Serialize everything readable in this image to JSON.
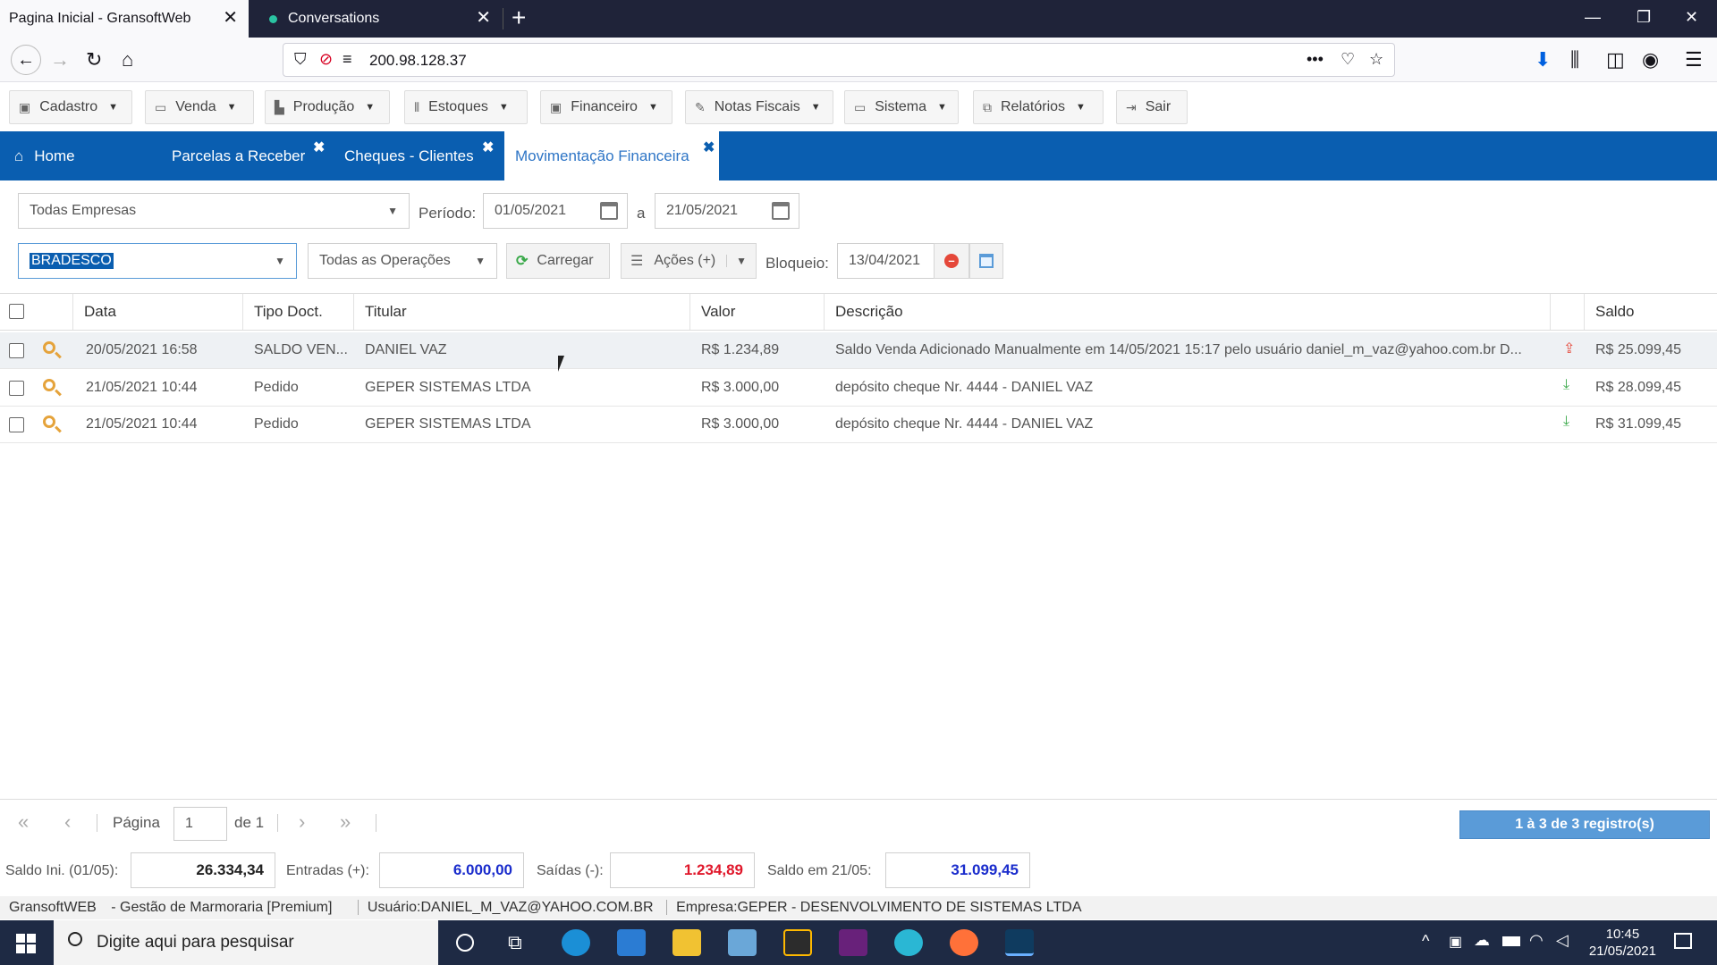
{
  "browser": {
    "tabs": [
      {
        "title": "Pagina Inicial - GransoftWeb",
        "active": true
      },
      {
        "title": "Conversations",
        "active": false
      }
    ],
    "url": "200.98.128.37"
  },
  "menu": [
    {
      "label": "Cadastro"
    },
    {
      "label": "Venda"
    },
    {
      "label": "Produção"
    },
    {
      "label": "Estoques"
    },
    {
      "label": "Financeiro"
    },
    {
      "label": "Notas Fiscais"
    },
    {
      "label": "Sistema"
    },
    {
      "label": "Relatórios"
    },
    {
      "label": "Sair"
    }
  ],
  "app_tabs": [
    {
      "label": "Home"
    },
    {
      "label": "Parcelas a Receber"
    },
    {
      "label": "Cheques - Clientes"
    },
    {
      "label": "Movimentação Financeira"
    }
  ],
  "filters": {
    "empresa": "Todas Empresas",
    "periodo_label": "Período:",
    "date_from": "01/05/2021",
    "a_label": "a",
    "date_to": "21/05/2021",
    "conta": "BRADESCO",
    "operacoes": "Todas as Operações",
    "carregar": "Carregar",
    "acoes": "Ações (+)",
    "bloqueio_label": "Bloqueio:",
    "bloqueio_date": "13/04/2021"
  },
  "grid": {
    "headers": {
      "data": "Data",
      "tipo": "Tipo Doct.",
      "titular": "Titular",
      "valor": "Valor",
      "descricao": "Descrição",
      "saldo": "Saldo"
    },
    "rows": [
      {
        "data": "20/05/2021 16:58",
        "tipo": "SALDO VEN...",
        "titular": "DANIEL VAZ",
        "valor": "R$ 1.234,89",
        "descricao": "Saldo Venda Adicionado Manualmente em 14/05/2021 15:17 pelo usuário daniel_m_vaz@yahoo.com.br D...",
        "saldo": "R$ 25.099,45",
        "direction": "out"
      },
      {
        "data": "21/05/2021 10:44",
        "tipo": "Pedido",
        "titular": "GEPER SISTEMAS LTDA",
        "valor": "R$ 3.000,00",
        "descricao": "depósito cheque Nr. 4444 - DANIEL VAZ",
        "saldo": "R$ 28.099,45",
        "direction": "in"
      },
      {
        "data": "21/05/2021 10:44",
        "tipo": "Pedido",
        "titular": "GEPER SISTEMAS LTDA",
        "valor": "R$ 3.000,00",
        "descricao": "depósito cheque Nr. 4444 - DANIEL VAZ",
        "saldo": "R$ 31.099,45",
        "direction": "in"
      }
    ]
  },
  "pager": {
    "pagina_label": "Página",
    "page": "1",
    "de_label": "de 1",
    "records": "1 à 3 de 3 registro(s)"
  },
  "totals": {
    "saldo_ini_label": "Saldo Ini. (01/05):",
    "saldo_ini": "26.334,34",
    "entradas_label": "Entradas (+):",
    "entradas": "6.000,00",
    "saidas_label": "Saídas (-):",
    "saidas": "1.234,89",
    "saldo_em_label": "Saldo em 21/05:",
    "saldo_em": "31.099,45"
  },
  "status": {
    "app": "GransoftWEB",
    "app_suffix": " - Gestão de Marmoraria [Premium]",
    "usuario": "Usuário:DANIEL_M_VAZ@YAHOO.COM.BR",
    "empresa": "Empresa:GEPER - DESENVOLVIMENTO DE SISTEMAS LTDA"
  },
  "taskbar": {
    "search_placeholder": "Digite aqui para pesquisar",
    "time": "10:45",
    "date": "21/05/2021"
  },
  "colors": {
    "app_tab_bar": "#0a5eb0",
    "active_tab_text": "#2e75c6",
    "entradas": "#1a2ccc",
    "saidas": "#e0182b",
    "records_badge": "#5a9bd8"
  }
}
